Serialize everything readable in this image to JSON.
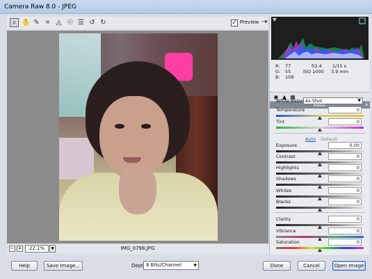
{
  "window": {
    "title": "Camera Raw 8.0  -  JPEG"
  },
  "toolbar": {
    "tools": [
      {
        "name": "zoom-tool",
        "glyph": "🔍",
        "active": true
      },
      {
        "name": "hand-tool",
        "glyph": "✋",
        "active": false
      },
      {
        "name": "white-balance-tool",
        "glyph": "✎",
        "active": false
      },
      {
        "name": "crop-tool",
        "glyph": "⌗",
        "active": false
      },
      {
        "name": "straighten-tool",
        "glyph": "◬",
        "active": false
      },
      {
        "name": "red-eye-tool",
        "glyph": "☉",
        "active": false
      },
      {
        "name": "preferences-tool",
        "glyph": "☰",
        "active": false
      },
      {
        "name": "rotate-left-tool",
        "glyph": "↺",
        "active": false
      },
      {
        "name": "rotate-right-tool",
        "glyph": "↻",
        "active": false
      }
    ],
    "preview_label": "Preview",
    "preview_checked": true
  },
  "status": {
    "zoom": "22.1%",
    "filename": "IMG_0798.JPG"
  },
  "readout": {
    "r": "R:",
    "r_val": "77",
    "g": "G:",
    "g_val": "55",
    "b": "B:",
    "b_val": "109",
    "aperture": "f/2.4",
    "shutter": "1/15 s",
    "iso": "ISO 1000",
    "focal": "3.9 mm"
  },
  "panel": {
    "title": "Basic",
    "white_balance_label": "White Balance:",
    "white_balance_value": "As Shot",
    "auto_label": "Auto",
    "default_label": "Default",
    "sliders": [
      {
        "label": "Temperature",
        "value": "0",
        "pos": 0.5,
        "track": "temp"
      },
      {
        "label": "Tint",
        "value": "0",
        "pos": 0.5,
        "track": "tint"
      },
      {
        "label": "Exposure",
        "value": "0.00",
        "pos": 0.5,
        "track": "gray"
      },
      {
        "label": "Contrast",
        "value": "0",
        "pos": 0.5,
        "track": "gray"
      },
      {
        "label": "Highlights",
        "value": "0",
        "pos": 0.5,
        "track": "gray"
      },
      {
        "label": "Shadows",
        "value": "0",
        "pos": 0.5,
        "track": "gray"
      },
      {
        "label": "Whites",
        "value": "0",
        "pos": 0.5,
        "track": "gray"
      },
      {
        "label": "Blacks",
        "value": "0",
        "pos": 0.5,
        "track": "gray"
      },
      {
        "label": "Clarity",
        "value": "0",
        "pos": 0.5,
        "track": "gray"
      },
      {
        "label": "Vibrance",
        "value": "0",
        "pos": 0.5,
        "track": "vib"
      },
      {
        "label": "Saturation",
        "value": "0",
        "pos": 0.5,
        "track": "sat"
      }
    ]
  },
  "footer": {
    "help_label": "Help",
    "save_label": "Save Image...",
    "depth_label": "Depth:",
    "depth_value": "8 Bits/Channel",
    "done_label": "Done",
    "cancel_label": "Cancel",
    "open_label": "Open Image"
  },
  "colors": {
    "panel_header": "#7f8894",
    "image_bg": "#8b8b8b",
    "primary_border": "#3b6ed0"
  }
}
